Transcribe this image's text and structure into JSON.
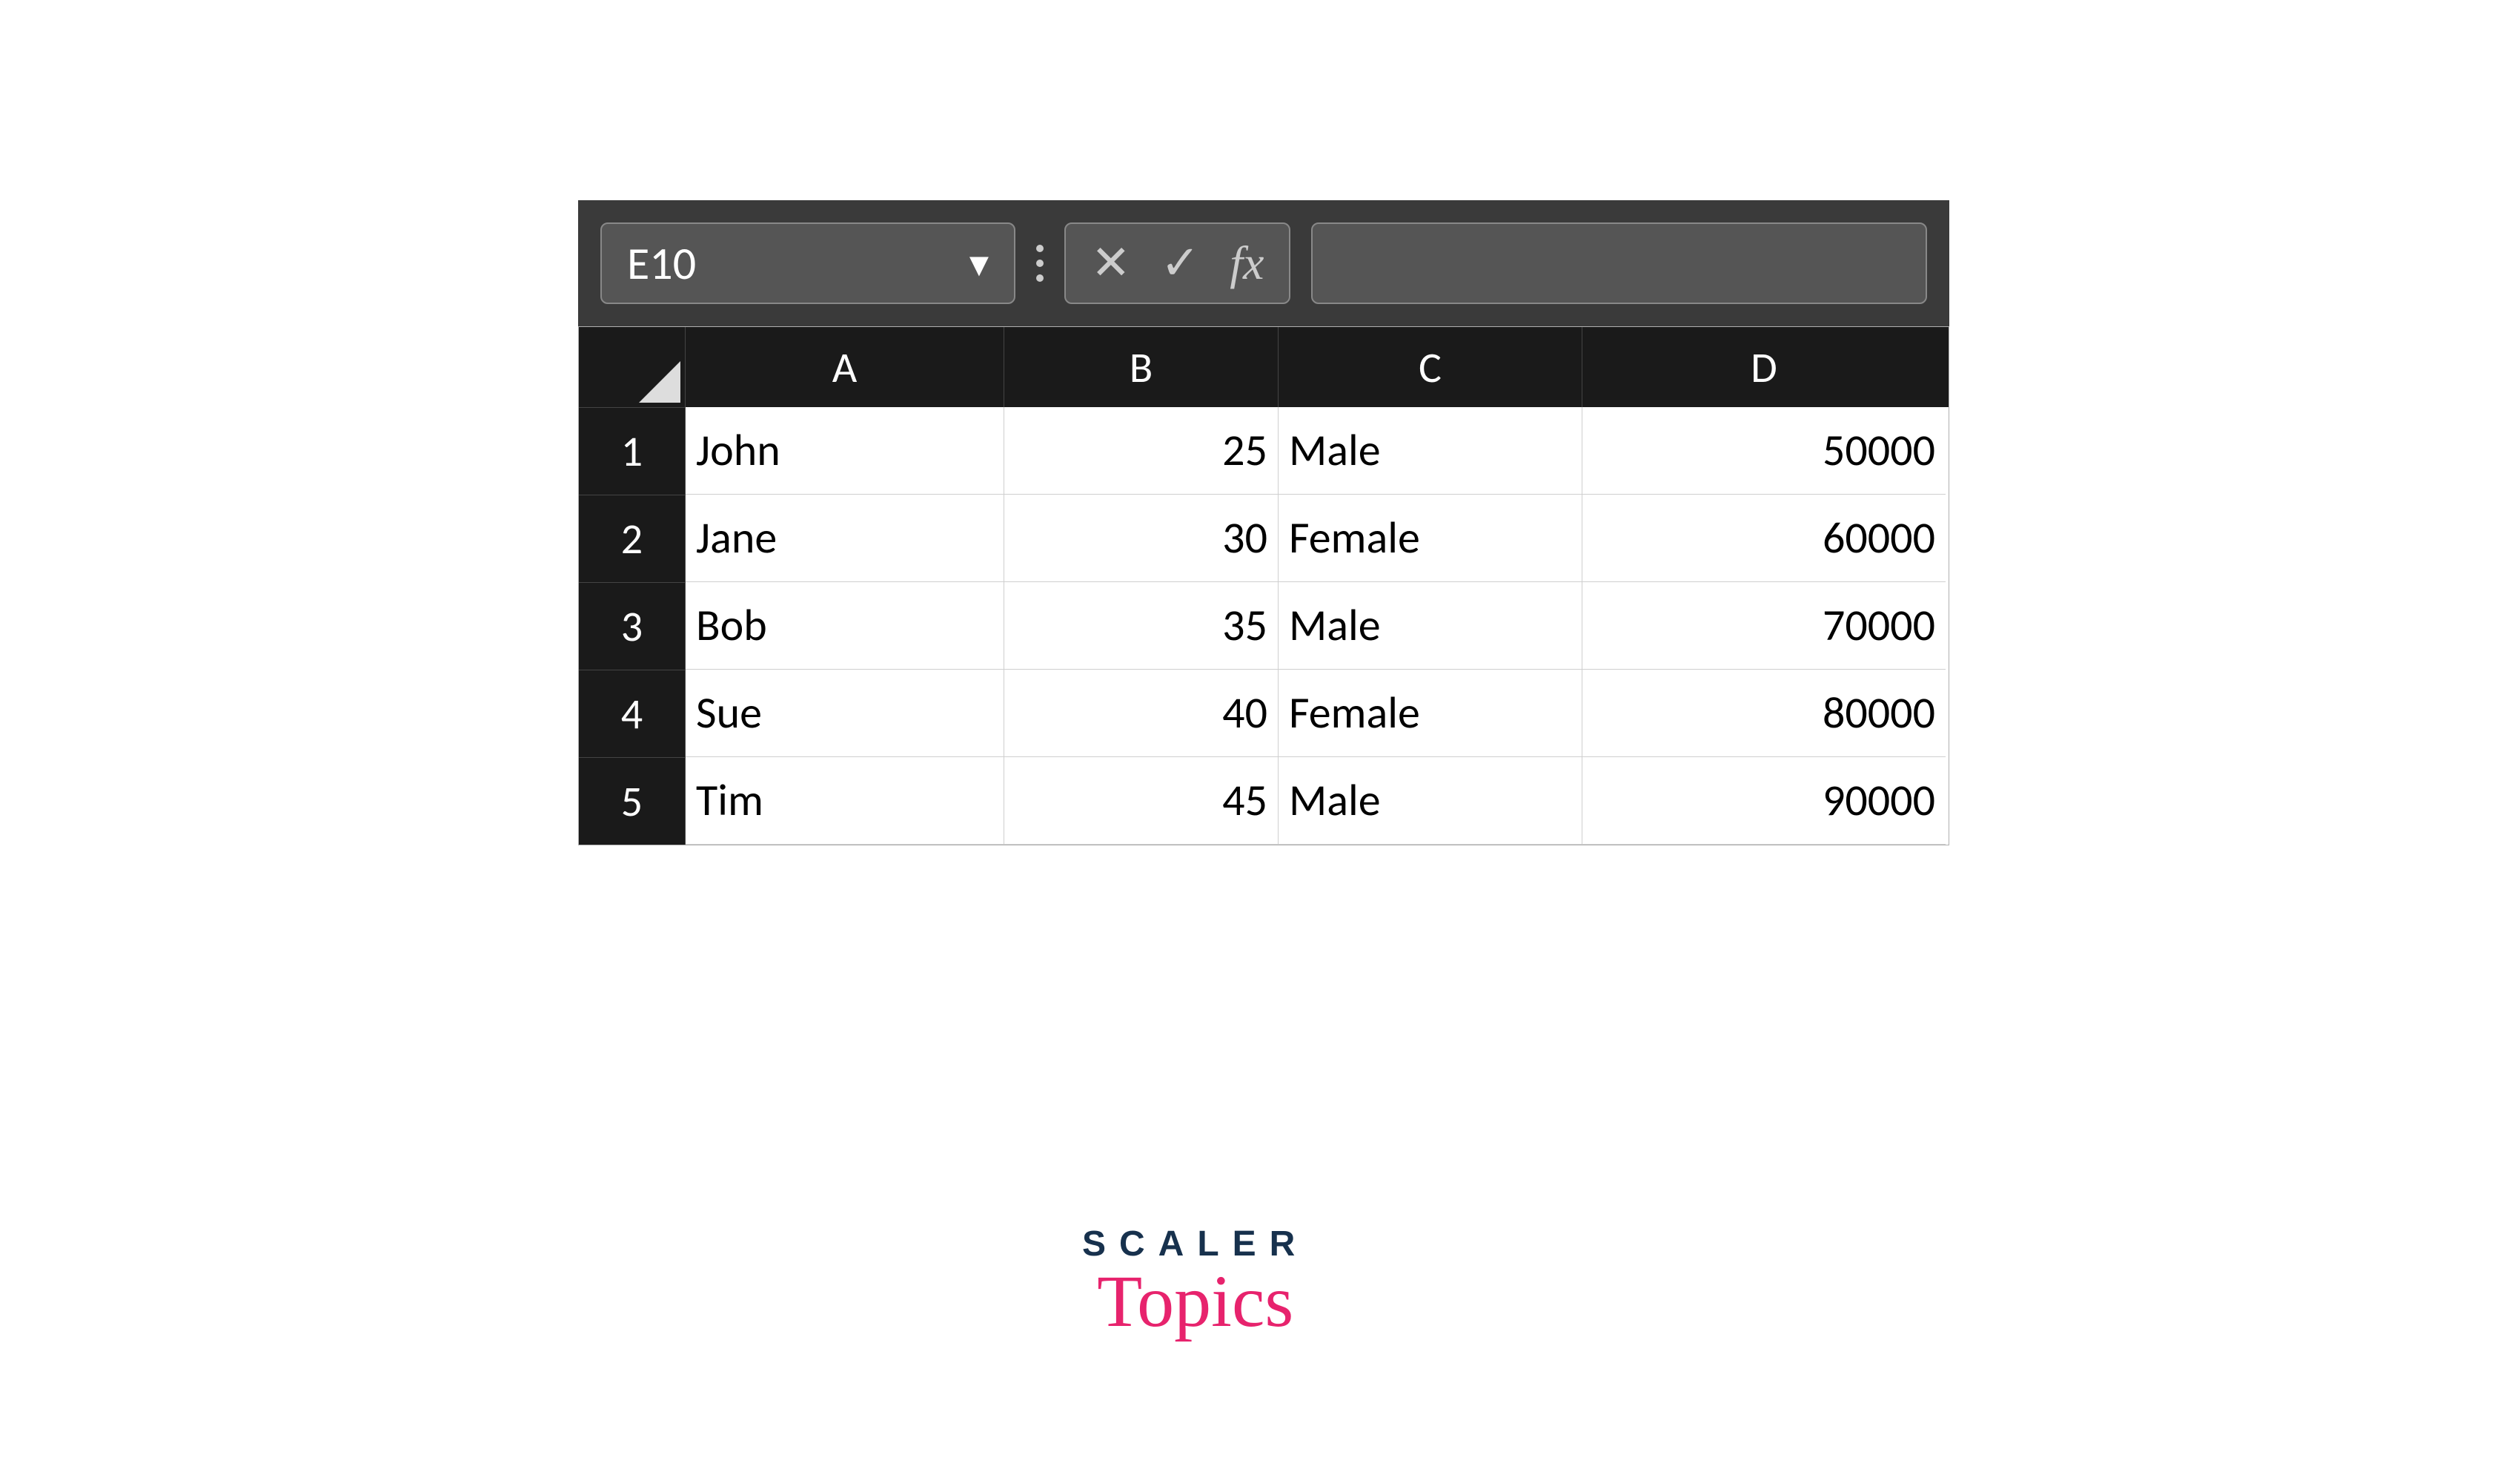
{
  "toolbar": {
    "name_box_value": "E10",
    "cancel_icon": "✕",
    "confirm_icon": "✓",
    "fx_label": "fx"
  },
  "columns": [
    "A",
    "B",
    "C",
    "D"
  ],
  "rows": [
    {
      "num": "1",
      "A": "John",
      "B": "25",
      "C": "Male",
      "D": "50000"
    },
    {
      "num": "2",
      "A": "Jane",
      "B": "30",
      "C": "Female",
      "D": "60000"
    },
    {
      "num": "3",
      "A": "Bob",
      "B": "35",
      "C": "Male",
      "D": "70000"
    },
    {
      "num": "4",
      "A": "Sue",
      "B": "40",
      "C": "Female",
      "D": "80000"
    },
    {
      "num": "5",
      "A": "Tim",
      "B": "45",
      "C": "Male",
      "D": "90000"
    }
  ],
  "brand": {
    "line1": "SCALER",
    "line2": "Topics"
  }
}
